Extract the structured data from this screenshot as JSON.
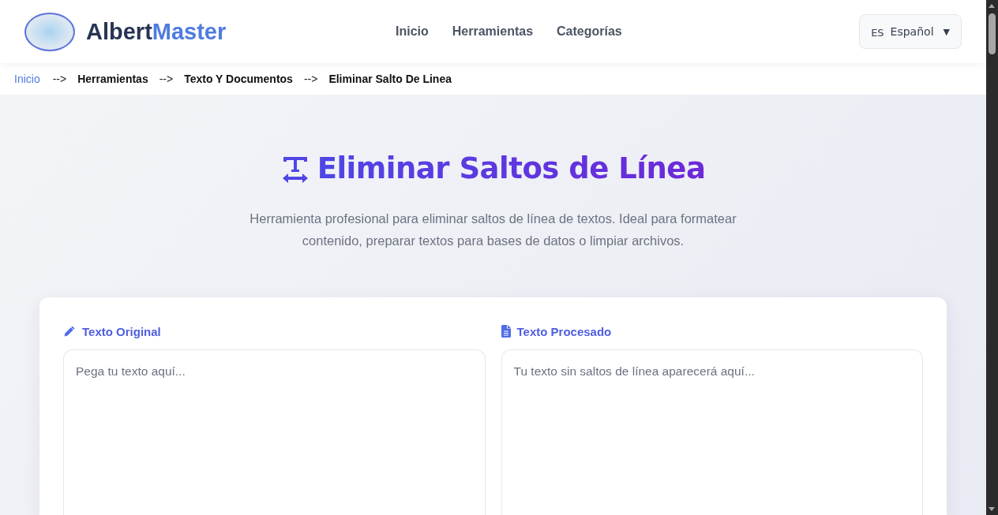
{
  "header": {
    "brand": {
      "part_1": "Albert",
      "part_2": "Master"
    },
    "nav": [
      "Inicio",
      "Herramientas",
      "Categorías"
    ],
    "language": {
      "code": "ES",
      "label": "Español",
      "caret": "▼"
    }
  },
  "breadcrumb": [
    {
      "label": "Inicio",
      "kind": "link"
    },
    {
      "label": "-->",
      "kind": "separator"
    },
    {
      "label": "Herramientas",
      "kind": "crumb"
    },
    {
      "label": "-->",
      "kind": "separator"
    },
    {
      "label": "Texto Y Documentos",
      "kind": "crumb"
    },
    {
      "label": "-->",
      "kind": "separator"
    },
    {
      "label": "Eliminar Salto De Linea",
      "kind": "crumb"
    }
  ],
  "hero": {
    "title": "Eliminar Saltos de Línea",
    "description": "Herramienta profesional para eliminar saltos de línea de textos. Ideal para formatear contenido, preparar textos para bases de datos o limpiar archivos."
  },
  "panels": [
    {
      "kind": "input",
      "label": "Texto Original",
      "placeholder": "Pega tu texto aquí..."
    },
    {
      "kind": "output",
      "label": "Texto Procesado",
      "placeholder": "Tu texto sin saltos de línea aparecerá aquí..."
    }
  ]
}
